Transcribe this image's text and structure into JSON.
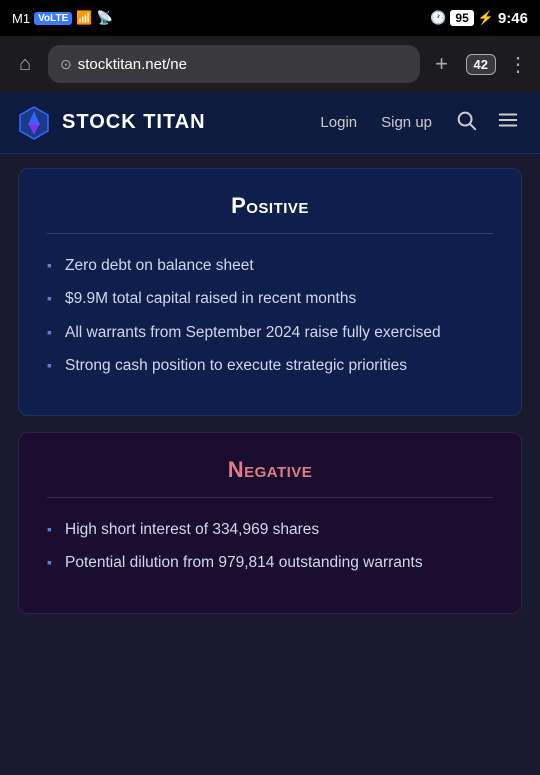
{
  "statusBar": {
    "carrier": "M1",
    "network": "VoLTE 4G",
    "alarm_icon": "🕐",
    "battery_level": "95",
    "time": "9:46"
  },
  "browser": {
    "home_icon": "⌂",
    "url": "stocktitan.net/ne",
    "add_tab_icon": "+",
    "tabs_count": "42",
    "menu_icon": "⋮"
  },
  "nav": {
    "logo_text": "STOCK TITAN",
    "login_label": "Login",
    "signup_label": "Sign up",
    "search_icon": "search",
    "menu_icon": "menu"
  },
  "positive": {
    "title": "Positive",
    "bullets": [
      "Zero debt on balance sheet",
      "$9.9M total capital raised in recent months",
      "All warrants from September 2024 raise fully exercised",
      "Strong cash position to execute strategic priorities"
    ]
  },
  "negative": {
    "title": "Negative",
    "bullets": [
      "High short interest of 334,969 shares",
      "Potential dilution from 979,814 outstanding warrants"
    ]
  }
}
